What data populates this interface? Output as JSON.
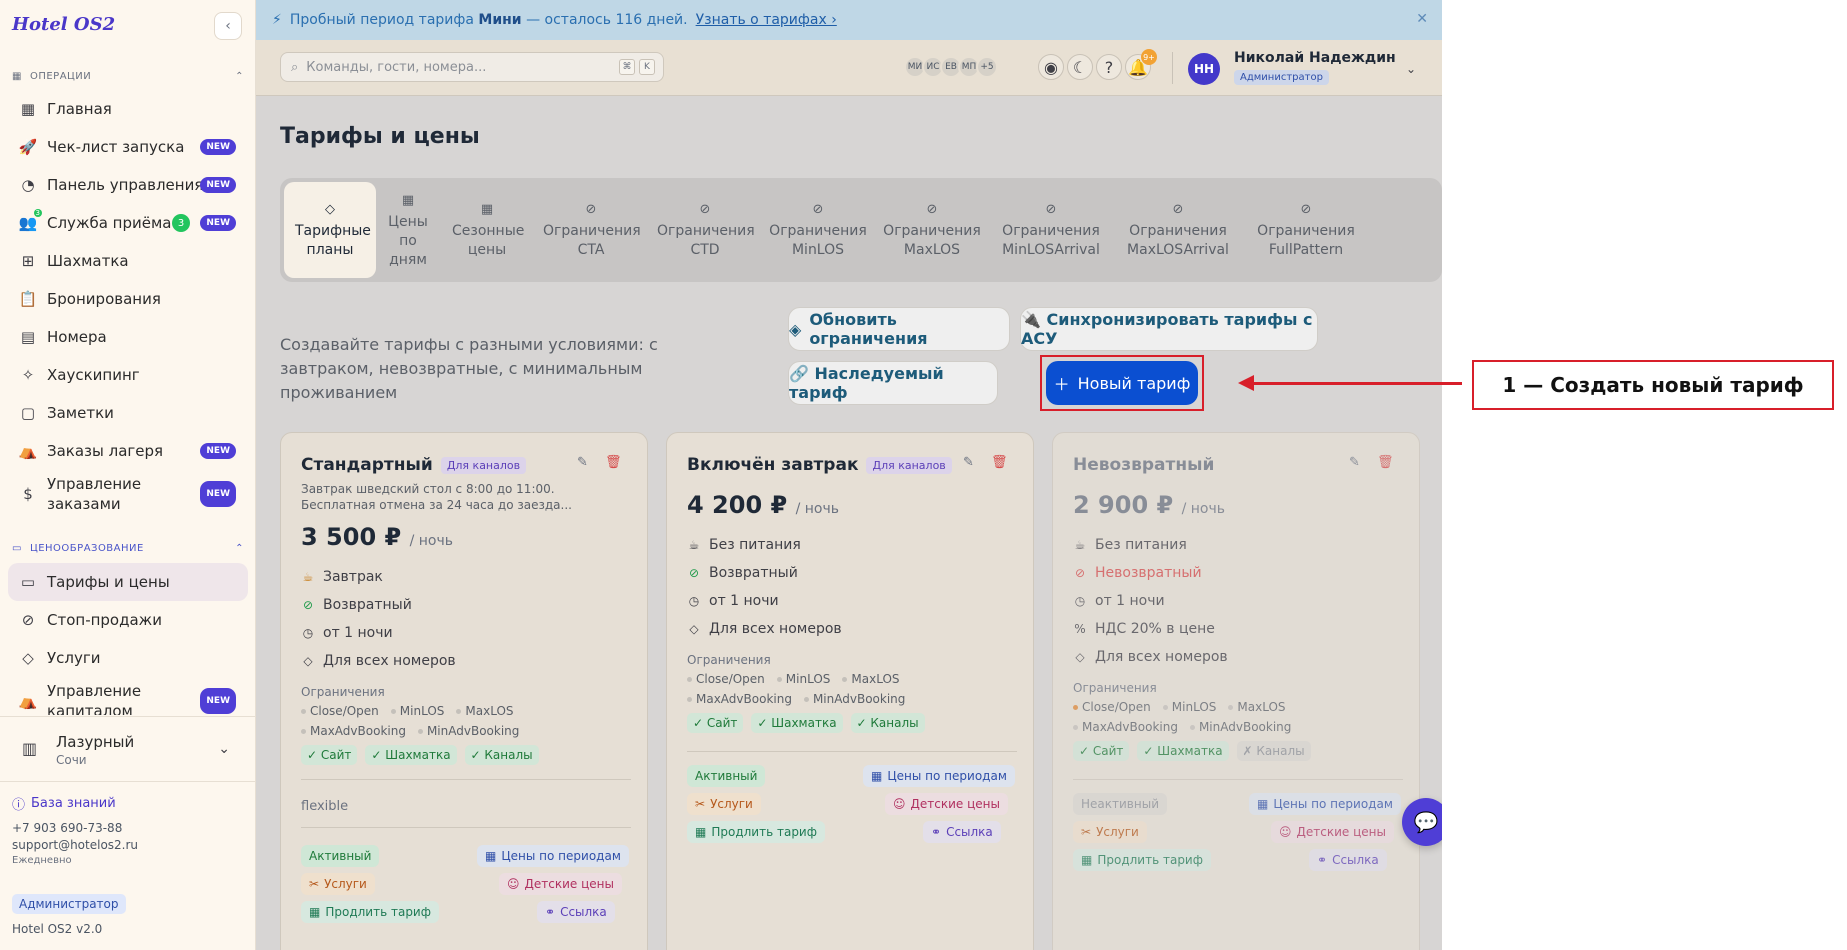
{
  "app": {
    "logo": "Hotel OS2"
  },
  "sidebar": {
    "sections": [
      {
        "label": "ОПЕРАЦИИ"
      },
      {
        "label": "ЦЕНООБРАЗОВАНИЕ"
      }
    ],
    "items": [
      {
        "label": "Главная",
        "icon": "home-grid-icon"
      },
      {
        "label": "Чек-лист запуска",
        "icon": "rocket-icon",
        "badge": "NEW"
      },
      {
        "label": "Панель управления",
        "icon": "gauge-icon",
        "badge": "NEW"
      },
      {
        "label": "Служба приёма",
        "icon": "users-icon",
        "count": "3",
        "icon_count": "3",
        "badge": "NEW"
      },
      {
        "label": "Шахматка",
        "icon": "table-icon"
      },
      {
        "label": "Бронирования",
        "icon": "clipboard-icon"
      },
      {
        "label": "Номера",
        "icon": "building-icon"
      },
      {
        "label": "Хаускипинг",
        "icon": "sparkles-icon"
      },
      {
        "label": "Заметки",
        "icon": "note-icon"
      },
      {
        "label": "Заказы лагеря",
        "icon": "tent-icon",
        "badge": "NEW"
      },
      {
        "label": "Управление заказами",
        "icon": "dollar-icon",
        "badge": "NEW"
      },
      {
        "label": "Тарифы и цены",
        "icon": "card-icon"
      },
      {
        "label": "Стоп-продажи",
        "icon": "ban-icon"
      },
      {
        "label": "Услуги",
        "icon": "tag-icon"
      },
      {
        "label": "Управление капиталом",
        "icon": "tent-icon",
        "badge": "NEW"
      }
    ],
    "hotel": {
      "name": "Лазурный",
      "city": "Сочи"
    },
    "footer": {
      "knowledge": "База знаний",
      "phone": "+7 903 690-73-88",
      "email": "support@hotelos2.ru",
      "schedule": "Ежедневно",
      "role": "Администратор",
      "version": "Hotel OS2 v2.0"
    }
  },
  "trial": {
    "prefix": "Пробный период тарифа",
    "plan": "Мини",
    "rest": "— осталось 116 дней.",
    "link": "Узнать о тарифах ›"
  },
  "topbar": {
    "search_placeholder": "Команды, гости, номера...",
    "key1": "⌘",
    "key2": "K",
    "avatars": [
      "МИ",
      "ИС",
      "ЕВ",
      "МП",
      "+5"
    ],
    "notif_count": "9+",
    "user": {
      "initials": "НН",
      "name": "Николай Надеждин",
      "role": "Администратор"
    }
  },
  "page": {
    "title": "Тарифы и цены",
    "tabs": [
      "Тарифные планы",
      "Цены по дням",
      "Сезонные цены",
      "Ограничения CTA",
      "Ограничения CTD",
      "Ограничения MinLOS",
      "Ограничения MaxLOS",
      "Ограничения MinLOSArrival",
      "Ограничения MaxLOSArrival",
      "Ограничения FullPattern"
    ],
    "description": "Создавайте тарифы с разными условиями: с завтраком, невозвратные, с минимальным проживанием",
    "buttons": {
      "refresh": "Обновить ограничения",
      "sync": "🔌 Синхронизировать тарифы с АСУ",
      "inherit": "🔗 Наследуемый тариф",
      "new": "Новый тариф"
    }
  },
  "cards": [
    {
      "name": "Стандартный",
      "channel": "Для каналов",
      "desc": "Завтрак шведский стол с 8:00 до 11:00. Бесплатная отмена за 24 часа до заезда...",
      "price": "3 500 ₽",
      "per": "/ ночь",
      "features": [
        "Завтрак",
        "Возвратный",
        "от 1 ночи",
        "Для всех номеров"
      ],
      "restr_title": "Ограничения",
      "restr": [
        "Close/Open",
        "MinLOS",
        "MaxLOS",
        "MaxAdvBooking",
        "MinAdvBooking"
      ],
      "ticks": [
        "✓ Сайт",
        "✓ Шахматка",
        "✓ Каналы"
      ],
      "extra": "flexible",
      "status": "Активный",
      "links": [
        "Цены по периодам",
        "Услуги",
        "Детские цены",
        "Продлить тариф",
        "Ссылка"
      ]
    },
    {
      "name": "Включён завтрак",
      "channel": "Для каналов",
      "price": "4 200 ₽",
      "per": "/ ночь",
      "features": [
        "Без питания",
        "Возвратный",
        "от 1 ночи",
        "Для всех номеров"
      ],
      "restr_title": "Ограничения",
      "restr": [
        "Close/Open",
        "MinLOS",
        "MaxLOS",
        "MaxAdvBooking",
        "MinAdvBooking"
      ],
      "ticks": [
        "✓ Сайт",
        "✓ Шахматка",
        "✓ Каналы"
      ],
      "status": "Активный",
      "links": [
        "Цены по периодам",
        "Услуги",
        "Детские цены",
        "Продлить тариф",
        "Ссылка"
      ]
    },
    {
      "name": "Невозвратный",
      "price": "2 900 ₽",
      "per": "/ ночь",
      "features": [
        "Без питания",
        "Невозвратный",
        "от 1 ночи",
        "НДС 20% в цене",
        "Для всех номеров"
      ],
      "restr_title": "Ограничения",
      "restr": [
        "Close/Open",
        "MinLOS",
        "MaxLOS",
        "MaxAdvBooking",
        "MinAdvBooking"
      ],
      "ticks": [
        "✓ Сайт",
        "✓ Шахматка",
        "✗ Каналы"
      ],
      "status": "Неактивный",
      "links": [
        "Цены по периодам",
        "Услуги",
        "Детские цены",
        "Продлить тариф",
        "Ссылка"
      ]
    }
  ],
  "annotation": {
    "label": "1 — Создать новый тариф"
  },
  "colors": {
    "accent": "#4f3ed6",
    "primary_button": "#0b4fd1",
    "annotation": "#d81f2a"
  }
}
